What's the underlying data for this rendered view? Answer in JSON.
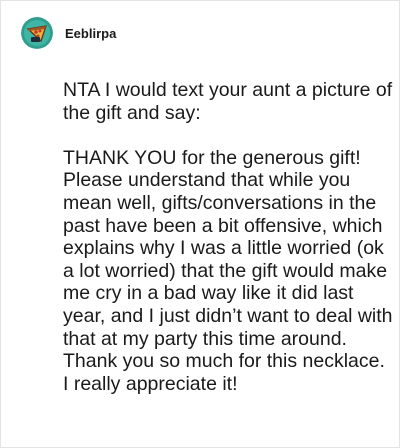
{
  "comment": {
    "author": "Eeblirpa",
    "avatar_icon": "pizza-slice-avatar-icon",
    "body": "NTA I would text your aunt a picture of the gift and say:\n\nTHANK YOU for the generous gift! Please understand that while you mean well, gifts/conversations in the past have been a bit offensive, which explains why I was a little worried (ok a lot worried) that the gift would make me cry in a bad way like it did last year, and I just didn’t want to deal with that at my party this time around. Thank you so much for this necklace. I really appreciate it!"
  },
  "colors": {
    "avatar_bg": "#2f9e8f",
    "text": "#1a1a1a",
    "border": "#e3e3e3"
  }
}
